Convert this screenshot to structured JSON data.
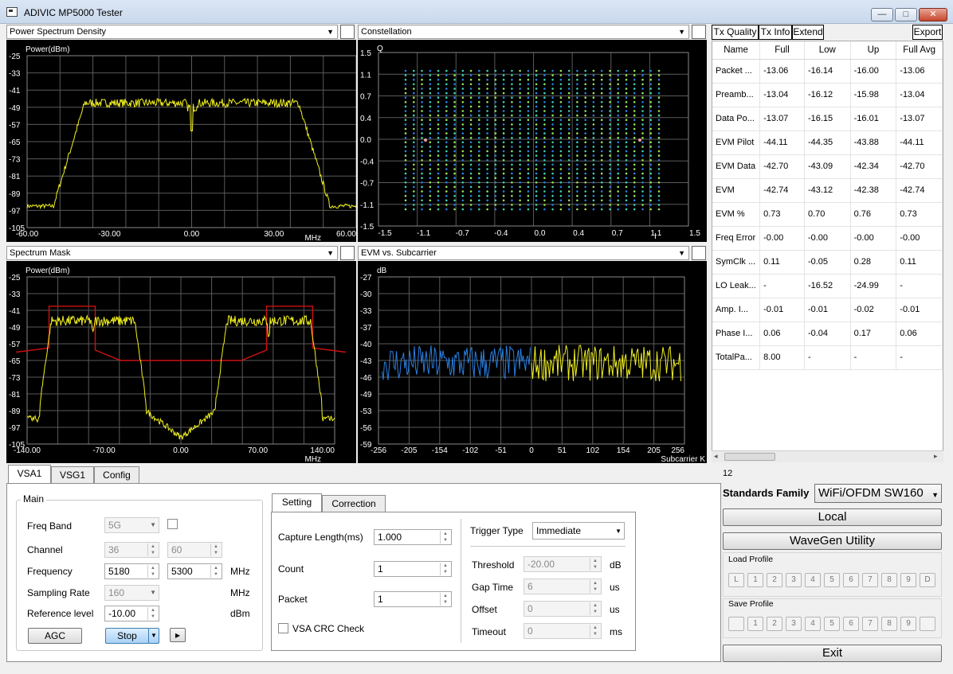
{
  "window": {
    "title": "ADIVIC MP5000 Tester",
    "minimize": "—",
    "maximize": "□",
    "close": "✕"
  },
  "plots": {
    "psd": {
      "selector": "Power Spectrum Density",
      "ylabel": "Power(dBm)",
      "yticks": [
        "-25",
        "-33",
        "-41",
        "-49",
        "-57",
        "-65",
        "-73",
        "-81",
        "-89",
        "-97",
        "-105"
      ],
      "xticks": [
        "-60.00",
        "-30.00",
        "0.00",
        "30.00",
        "60.00"
      ],
      "xunit": "MHz"
    },
    "constellation": {
      "selector": "Constellation",
      "ylabel": "Q",
      "yticks": [
        "1.5",
        "1.1",
        "0.7",
        "0.4",
        "0.0",
        "-0.4",
        "-0.7",
        "-1.1",
        "-1.5"
      ],
      "xticks": [
        "-1.5",
        "-1.1",
        "-0.7",
        "-0.4",
        "0.0",
        "0.4",
        "0.7",
        "1.1",
        "1.5"
      ],
      "xunit": "I"
    },
    "mask": {
      "selector": "Spectrum Mask",
      "ylabel": "Power(dBm)",
      "yticks": [
        "-25",
        "-33",
        "-41",
        "-49",
        "-57",
        "-65",
        "-73",
        "-81",
        "-89",
        "-97",
        "-105"
      ],
      "xticks": [
        "-140.00",
        "-70.00",
        "0.00",
        "70.00",
        "140.00"
      ],
      "xunit": "MHz"
    },
    "evm": {
      "selector": "EVM vs. Subcarrier",
      "ylabel": "dB",
      "yticks": [
        "-27",
        "-30",
        "-33",
        "-37",
        "-40",
        "-43",
        "-46",
        "-49",
        "-53",
        "-56",
        "-59"
      ],
      "xticks": [
        "-256",
        "-205",
        "-154",
        "-102",
        "-51",
        "0",
        "51",
        "102",
        "154",
        "205",
        "256"
      ],
      "xunit": "Subcarrier K"
    }
  },
  "right_tabs": {
    "tx_quality": "Tx Quality",
    "tx_info": "Tx Info",
    "extend": "Extend",
    "export": "Export"
  },
  "table": {
    "headers": [
      "Name",
      "Full",
      "Low",
      "Up",
      "Full Avg"
    ],
    "rows": [
      [
        "Packet ...",
        "-13.06",
        "-16.14",
        "-16.00",
        "-13.06"
      ],
      [
        "Preamb...",
        "-13.04",
        "-16.12",
        "-15.98",
        "-13.04"
      ],
      [
        "Data Po...",
        "-13.07",
        "-16.15",
        "-16.01",
        "-13.07"
      ],
      [
        "EVM Pilot",
        "-44.11",
        "-44.35",
        "-43.88",
        "-44.11"
      ],
      [
        "EVM Data",
        "-42.70",
        "-43.09",
        "-42.34",
        "-42.70"
      ],
      [
        "EVM",
        "-42.74",
        "-43.12",
        "-42.38",
        "-42.74"
      ],
      [
        "EVM %",
        "0.73",
        "0.70",
        "0.76",
        "0.73"
      ],
      [
        "Freq Error",
        "-0.00",
        "-0.00",
        "-0.00",
        "-0.00"
      ],
      [
        "SymClk ...",
        "0.11",
        "-0.05",
        "0.28",
        "0.11"
      ],
      [
        "LO Leak...",
        "-",
        "-16.52",
        "-24.99",
        "-"
      ],
      [
        "Amp. I...",
        "-0.01",
        "-0.01",
        "-0.02",
        "-0.01"
      ],
      [
        "Phase I...",
        "0.06",
        "-0.04",
        "0.17",
        "0.06"
      ],
      [
        "TotalPa...",
        "8.00",
        "-",
        "-",
        "-"
      ]
    ]
  },
  "bottom_tabs": [
    "VSA1",
    "VSG1",
    "Config"
  ],
  "main": {
    "legend": "Main",
    "freq_band_label": "Freq Band",
    "freq_band_value": "5G",
    "channel_label": "Channel",
    "channel1": "36",
    "channel2": "60",
    "frequency_label": "Frequency",
    "frequency1": "5180",
    "frequency2": "5300",
    "frequency_unit": "MHz",
    "sampling_label": "Sampling Rate",
    "sampling_value": "160",
    "sampling_unit": "MHz",
    "ref_label": "Reference level",
    "ref_value": "-10.00",
    "ref_unit": "dBm",
    "agc": "AGC",
    "stop": "Stop",
    "play": "▸"
  },
  "setting_tabs": [
    "Setting",
    "Correction"
  ],
  "setting": {
    "capture_label": "Capture Length(ms)",
    "capture_value": "1.000",
    "count_label": "Count",
    "count_value": "1",
    "packet_label": "Packet",
    "packet_value": "1",
    "crc_label": "VSA CRC Check",
    "trigger_label": "Trigger Type",
    "trigger_value": "Immediate",
    "threshold_label": "Threshold",
    "threshold_value": "-20.00",
    "threshold_unit": "dB",
    "gap_label": "Gap Time",
    "gap_value": "6",
    "gap_unit": "us",
    "offset_label": "Offset",
    "offset_value": "0",
    "offset_unit": "us",
    "timeout_label": "Timeout",
    "timeout_value": "0",
    "timeout_unit": "ms"
  },
  "side": {
    "counter": "12",
    "standards_label": "Standards Family",
    "standards_value": "WiFi/OFDM SW160",
    "local": "Local",
    "wavegen": "WaveGen Utility",
    "load_profile": "Load Profile",
    "load_buttons": [
      "L",
      "1",
      "2",
      "3",
      "4",
      "5",
      "6",
      "7",
      "8",
      "9",
      "D"
    ],
    "save_profile": "Save Profile",
    "save_buttons": [
      "",
      "1",
      "2",
      "3",
      "4",
      "5",
      "6",
      "7",
      "8",
      "9",
      ""
    ],
    "exit": "Exit"
  },
  "colors": {
    "trace": "#f0f020",
    "mask_line": "#d01010",
    "evm_low": "#2a7fe0",
    "grid": "#5a5a5a"
  }
}
